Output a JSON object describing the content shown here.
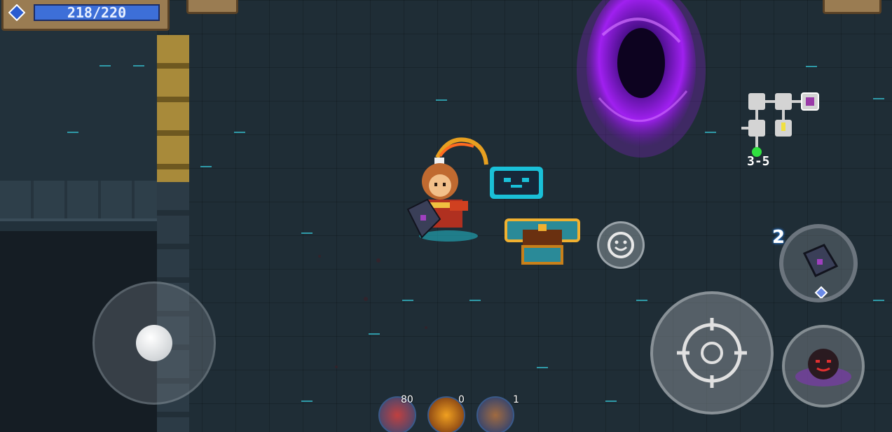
{
  "hud": {
    "mana": "218/220",
    "level": "3-5"
  },
  "buffs": [
    {
      "icon": "red-fist-buff-icon",
      "count": "80"
    },
    {
      "icon": "fire-fist-buff-icon",
      "count": "0"
    },
    {
      "icon": "shield-buff-icon",
      "count": "1"
    }
  ],
  "weapon": {
    "icon": "dark-cube-weapon-icon",
    "count": "2"
  },
  "colors": {
    "mana_bar": "#3d6fd8",
    "portal": "#a020f0",
    "panel": "#9a7c52"
  }
}
